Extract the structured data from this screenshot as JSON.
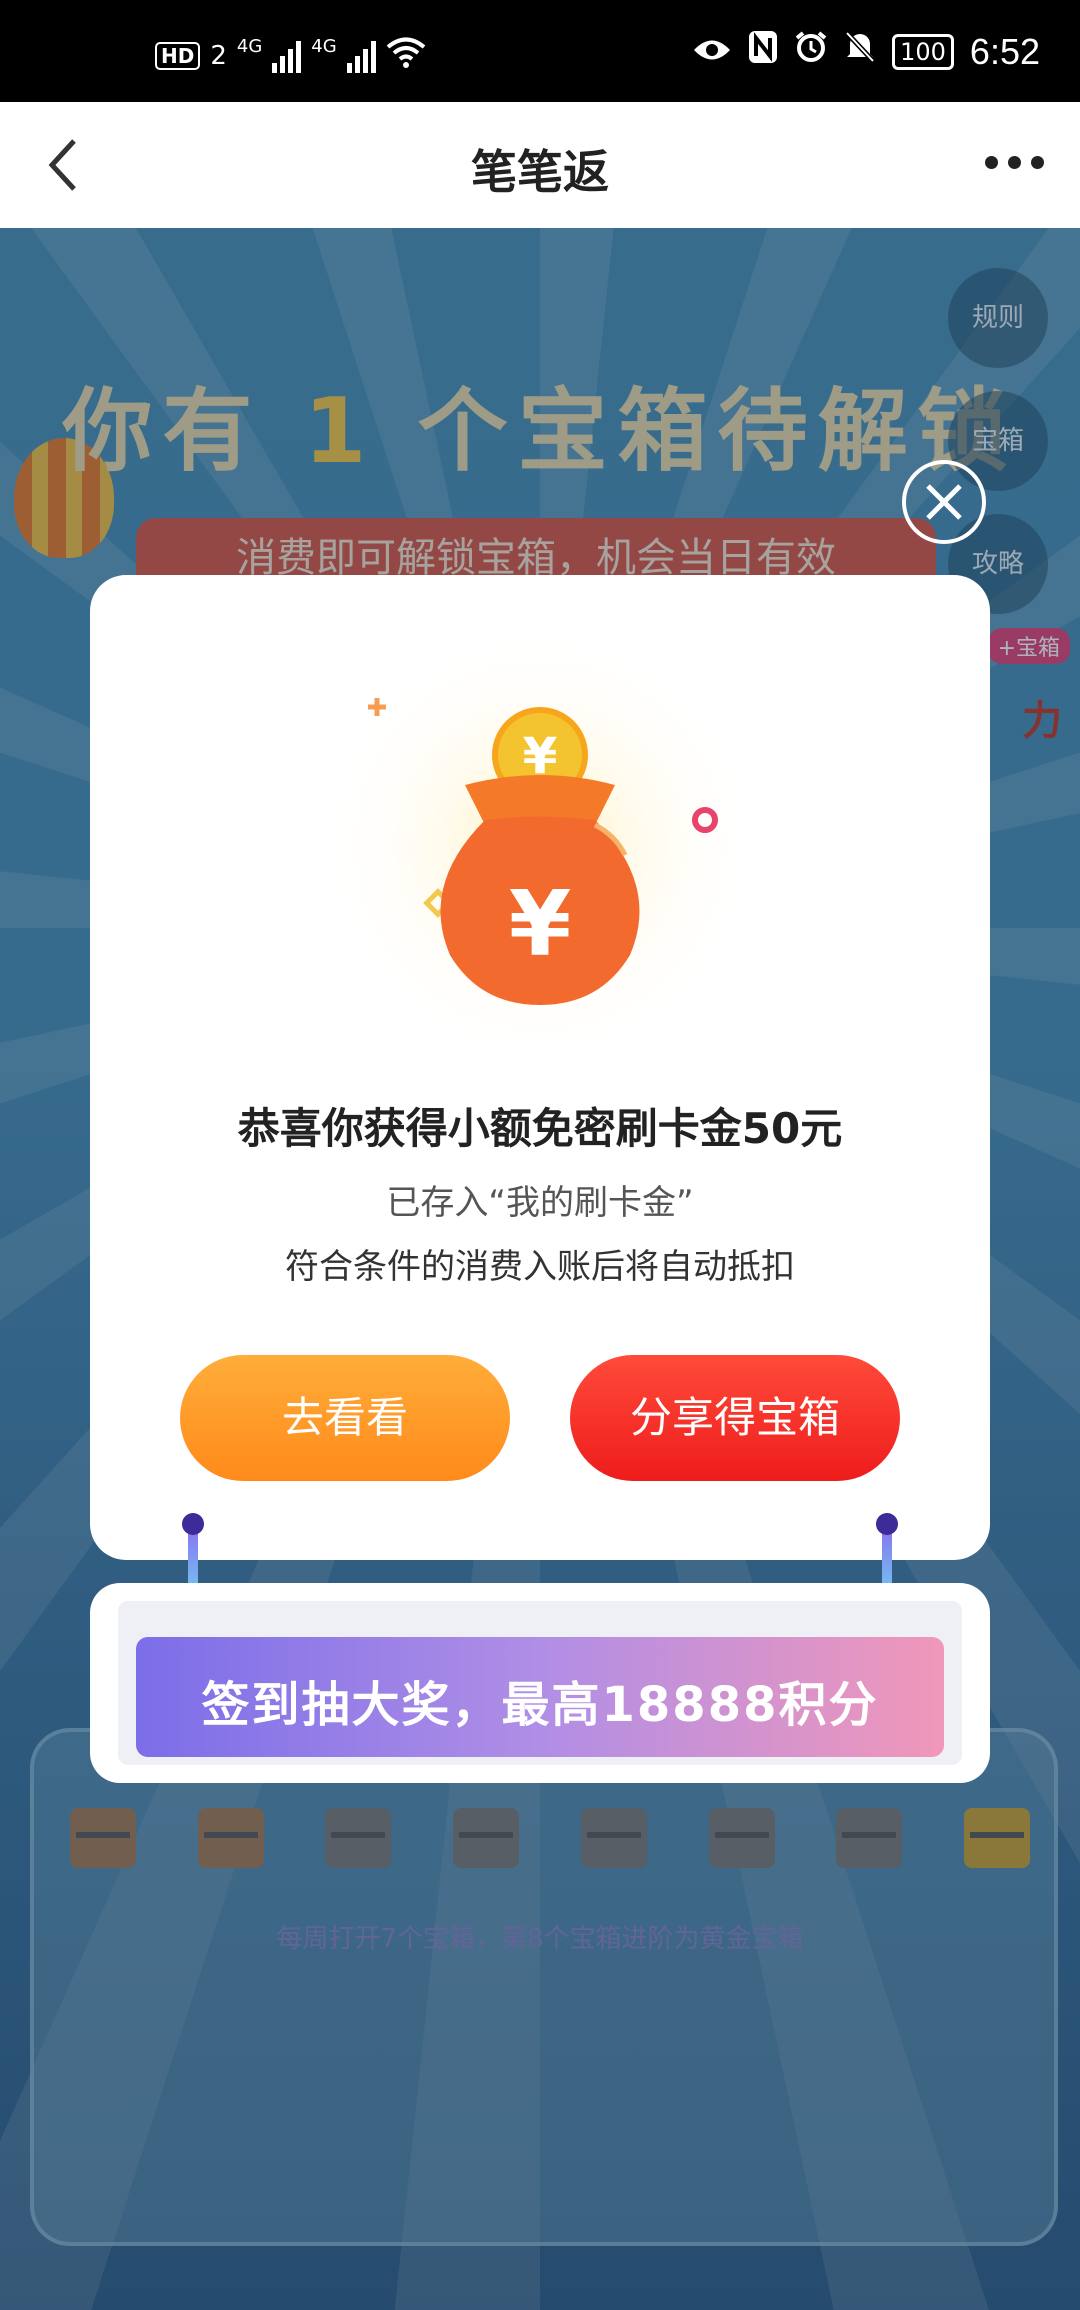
{
  "status_bar": {
    "hd": "HD",
    "sim": "2",
    "net1": "4G",
    "net2": "4G",
    "battery": "100",
    "time": "6:52"
  },
  "nav": {
    "title": "笔笔返"
  },
  "background": {
    "heading_prefix": "你有",
    "heading_count": "1",
    "heading_suffix": "个宝箱待解锁",
    "banner": "消费即可解锁宝箱，机会当日有效",
    "side_buttons": [
      "规则",
      "宝箱",
      "攻略"
    ],
    "boost_tag": "+宝箱",
    "boost_char": "力",
    "footnote": "每周打开7个宝箱，第8个宝箱进阶为黄金宝箱"
  },
  "modal": {
    "headline": "恭喜你获得小额免密刷卡金50元",
    "line1": "已存入“我的刷卡金”",
    "line2": "符合条件的消费入账后将自动抵扣",
    "btn_view": "去看看",
    "btn_share": "分享得宝箱",
    "banner_text": "签到抽大奖，最高18888积分"
  },
  "colors": {
    "accent_orange": "#ff9a22",
    "accent_red": "#f22a22",
    "banner_purple": "#8f7ae6"
  }
}
